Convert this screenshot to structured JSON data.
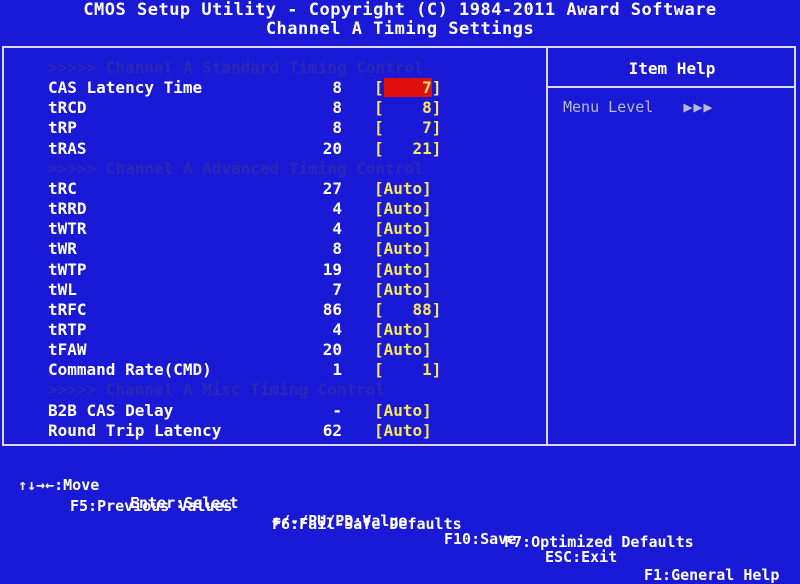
{
  "header": {
    "line1": "CMOS Setup Utility - Copyright (C) 1984-2011 Award Software",
    "line2": "Channel A Timing Settings"
  },
  "help_panel": {
    "title": "Item Help",
    "menu_level_label": "Menu Level",
    "menu_level_arrows": "▶▶▶"
  },
  "sections": [
    ">>>>> Channel A Standard Timing Control",
    ">>>>> Channel A Advanced Timing Control",
    ">>>>> Channel A Misc Timing Control"
  ],
  "items": [
    {
      "label": "CAS Latency Time",
      "current": "8",
      "setting": "[    7]",
      "selected": true
    },
    {
      "label": "tRCD",
      "current": "8",
      "setting": "[    8]"
    },
    {
      "label": "tRP",
      "current": "8",
      "setting": "[    7]"
    },
    {
      "label": "tRAS",
      "current": "20",
      "setting": "[   21]"
    },
    {
      "label": "tRC",
      "current": "27",
      "setting": "[Auto]"
    },
    {
      "label": "tRRD",
      "current": "4",
      "setting": "[Auto]"
    },
    {
      "label": "tWTR",
      "current": "4",
      "setting": "[Auto]"
    },
    {
      "label": "tWR",
      "current": "8",
      "setting": "[Auto]"
    },
    {
      "label": "tWTP",
      "current": "19",
      "setting": "[Auto]"
    },
    {
      "label": "tWL",
      "current": "7",
      "setting": "[Auto]"
    },
    {
      "label": "tRFC",
      "current": "86",
      "setting": "[   88]"
    },
    {
      "label": "tRTP",
      "current": "4",
      "setting": "[Auto]"
    },
    {
      "label": "tFAW",
      "current": "20",
      "setting": "[Auto]"
    },
    {
      "label": "Command Rate(CMD)",
      "current": "1",
      "setting": "[    1]"
    },
    {
      "label": "B2B CAS Delay",
      "current": "-",
      "setting": "[Auto]"
    },
    {
      "label": "Round Trip Latency",
      "current": "62",
      "setting": "[Auto]"
    }
  ],
  "footer": {
    "move": "↑↓→←:Move",
    "select": "Enter:Select",
    "value": "+/-/PU/PD:Value",
    "save": "F10:Save",
    "exit": "ESC:Exit",
    "help": "F1:General Help",
    "prev": "F5:Previous Values",
    "failsafe": "F6:Fail-Safe Defaults",
    "optimized": "F7:Optimized Defaults"
  },
  "colors": {
    "background": "#1a1ad6",
    "text": "#ffffff",
    "setting": "#f8e860",
    "selection": "#e01010",
    "section": "#2a2ab8"
  }
}
